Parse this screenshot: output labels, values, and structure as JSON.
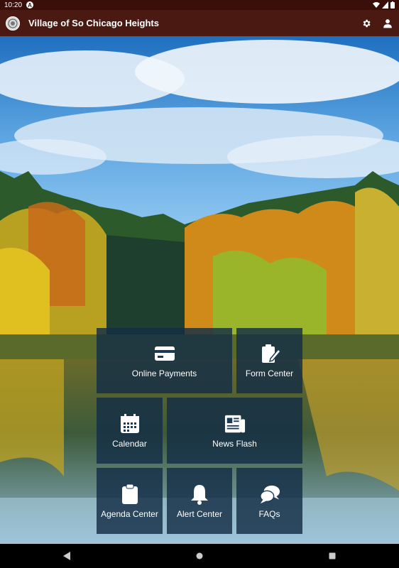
{
  "status_bar": {
    "time": "10:20",
    "notification_letter": "A"
  },
  "app_bar": {
    "title": "Village of So Chicago Heights",
    "settings_icon": "gear-icon",
    "account_icon": "person-icon"
  },
  "tiles": [
    {
      "label": "Online Payments",
      "icon": "credit-card-icon"
    },
    {
      "label": "Form Center",
      "icon": "clipboard-edit-icon"
    },
    {
      "label": "Calendar",
      "icon": "calendar-icon"
    },
    {
      "label": "News Flash",
      "icon": "newspaper-icon"
    },
    {
      "label": "Agenda Center",
      "icon": "clipboard-icon"
    },
    {
      "label": "Alert Center",
      "icon": "bell-icon"
    },
    {
      "label": "FAQs",
      "icon": "chat-bubbles-icon"
    }
  ],
  "colors": {
    "status_bar": "#3a0f0a",
    "app_bar": "#4a1a12",
    "tile": "#142d46"
  }
}
